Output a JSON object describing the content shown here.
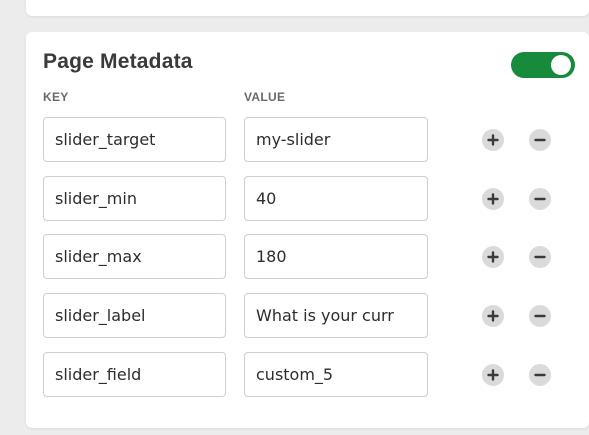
{
  "panel": {
    "title": "Page Metadata",
    "toggle_on": true,
    "columns": {
      "key": "KEY",
      "value": "VALUE"
    },
    "rows": [
      {
        "key": "slider_target",
        "value": "my-slider"
      },
      {
        "key": "slider_min",
        "value": "40"
      },
      {
        "key": "slider_max",
        "value": "180"
      },
      {
        "key": "slider_label",
        "value": "What is your curr"
      },
      {
        "key": "slider_field",
        "value": "custom_5"
      }
    ]
  },
  "colors": {
    "toggle_on": "#178a3b",
    "button_bg": "#dadada",
    "icon_stroke": "#3a3a3a"
  },
  "icons": {
    "add": "plus-icon",
    "remove": "minus-icon"
  }
}
